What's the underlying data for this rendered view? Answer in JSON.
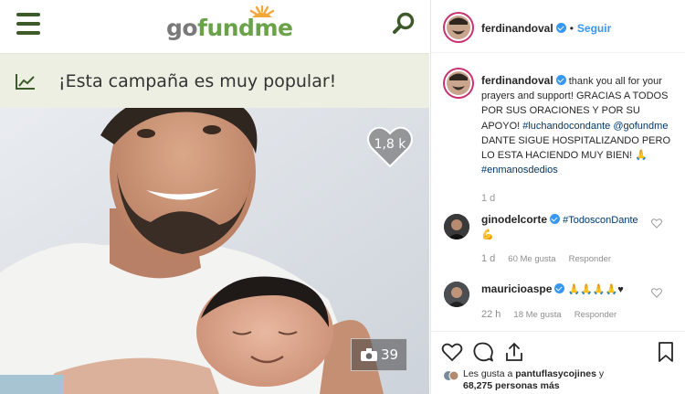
{
  "gofundme": {
    "logo_part1": "go",
    "logo_part2": "fundme",
    "popular_text": "¡Esta campaña es muy popular!",
    "heart_count": "1,8 k",
    "photo_count": "39",
    "colors": {
      "brand_green": "#3d5a2a",
      "logo_green": "#6aa24a",
      "bar_bg": "#eeefe3"
    }
  },
  "instagram": {
    "header": {
      "username": "ferdinandoval",
      "dot": "•",
      "follow_label": "Seguir"
    },
    "caption": {
      "username": "ferdinandoval",
      "text_1": "thank you all for your prayers and support! GRACIAS A TODOS POR SUS ORACIONES Y POR SU APOYO!",
      "hashtag_1": "#luchandocondante",
      "mention": "@gofundme",
      "text_2": "DANTE SIGUE HOSPITALIZANDO PERO LO ESTA HACIENDO MUY BIEN! 🙏",
      "hashtag_2": "#enmanosdedios",
      "time": "1 d"
    },
    "comments": [
      {
        "username": "ginodelcorte",
        "tag": "#TodosconDante",
        "emoji": "💪",
        "time": "1 d",
        "likes": "60 Me gusta",
        "reply": "Responder"
      },
      {
        "username": "mauricioaspe",
        "text": "🙏🙏🙏🙏♥",
        "time": "22 h",
        "likes": "18 Me gusta",
        "reply": "Responder"
      }
    ],
    "likes_line": {
      "prefix": "Les gusta a",
      "user": "pantuflasycojines",
      "middle": "y",
      "count": "68,275 personas más"
    },
    "colors": {
      "link_blue": "#3897f0",
      "hashtag": "#00376b"
    }
  }
}
